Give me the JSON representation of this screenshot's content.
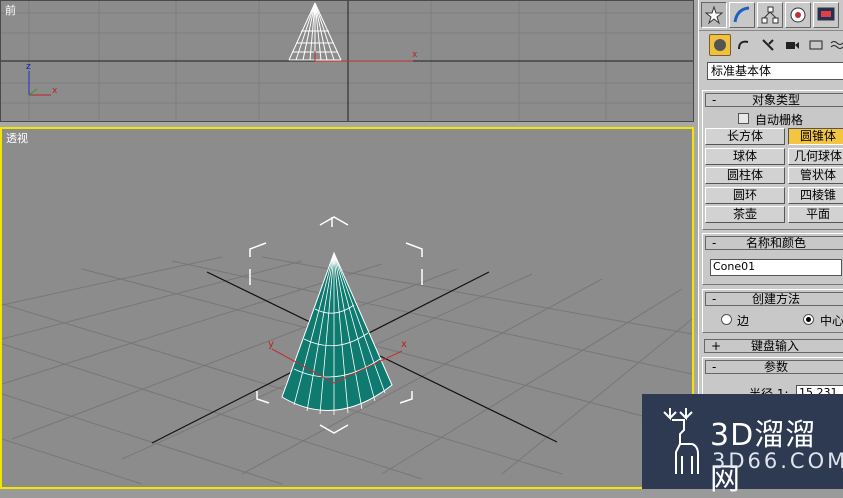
{
  "viewports": {
    "front": {
      "label": "前",
      "axis_x": "x",
      "axis_z": "z",
      "gizmo_x": "x"
    },
    "perspective": {
      "label": "透视",
      "gizmo_x": "x",
      "gizmo_y": "y"
    }
  },
  "panel": {
    "tabs": [
      "create-icon",
      "modify-icon",
      "hierarchy-icon",
      "motion-icon",
      "display-icon"
    ],
    "subtabs": [
      "geometry-icon",
      "shapes-icon",
      "lights-icon",
      "cameras-icon",
      "helpers-icon",
      "spacewarps-icon"
    ],
    "category_dropdown": "标准基本体",
    "object_type": {
      "title": "对象类型",
      "sign": "-",
      "autogrid_label": "自动栅格",
      "buttons": [
        "长方体",
        "圆锥体",
        "球体",
        "几何球体",
        "圆柱体",
        "管状体",
        "圆环",
        "四棱锥",
        "茶壶",
        "平面"
      ],
      "selected": "圆锥体"
    },
    "name_color": {
      "title": "名称和颜色",
      "sign": "-",
      "name_value": "Cone01",
      "swatch_color": "#087a78"
    },
    "creation_method": {
      "title": "创建方法",
      "sign": "-",
      "option_edge": "边",
      "option_center": "中心",
      "selected": "中心"
    },
    "keyboard_entry": {
      "title": "键盘输入",
      "sign": "+"
    },
    "parameters": {
      "title": "参数",
      "sign": "-",
      "radius1_label": "半径 1:",
      "radius1_value": "15.231"
    }
  },
  "watermark": {
    "title": "3D溜溜网",
    "sub": "3D66.COM"
  },
  "colors": {
    "viewport_bg": "#8c8c8c",
    "active_border": "#f2e600",
    "cone": "#0e7a70",
    "selected_button": "#f3c540",
    "watermark_bg": "#2d3a52"
  }
}
